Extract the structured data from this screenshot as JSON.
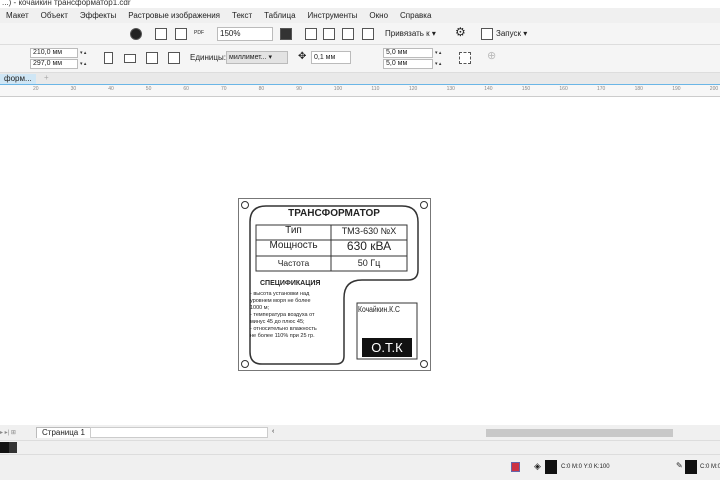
{
  "window": {
    "title": "...) - кочайкин трансформатор1.cdr"
  },
  "menu": [
    "Макет",
    "Объект",
    "Эффекты",
    "Растровые изображения",
    "Текст",
    "Таблица",
    "Инструменты",
    "Окно",
    "Справка"
  ],
  "toolbar": {
    "zoom": "150%",
    "snap_label": "Привязать к",
    "launch_label": "Запуск"
  },
  "propbar": {
    "width": "210,0 мм",
    "height": "297,0 мм",
    "units_label": "Единицы:",
    "units_value": "миллимет...",
    "nudge": "0,1 мм",
    "dup_x": "5,0 мм",
    "dup_y": "5,0 мм"
  },
  "doc_tab": "форм...",
  "ruler_ticks": [
    "20",
    "30",
    "40",
    "50",
    "60",
    "70",
    "80",
    "90",
    "100",
    "110",
    "120",
    "130",
    "140",
    "150",
    "160",
    "170",
    "180",
    "190",
    "200"
  ],
  "plate": {
    "title": "ТРАНСФОРМАТОР",
    "rows": [
      [
        "Тип",
        "ТМЗ-630 №X"
      ],
      [
        "Мощность",
        "630 кВА"
      ],
      [
        "Частота",
        "50 Гц"
      ]
    ],
    "spec_title": "СПЕЦИФИКАЦИЯ",
    "spec_lines": [
      "- высота установки над",
      "уровнем моря не более",
      "1000 м;",
      "- температура воздуха от",
      "минус 45 до плюс 45;",
      "- относительно влажность",
      "не более 110% при 25 гр."
    ],
    "signature": "Кочайкин.К.С",
    "stamp": "О.Т.К"
  },
  "page_tab": "Страница 1",
  "status": {
    "fill": "C:0 M:0 Y:0 K:100",
    "outline": "C:0 M:0 Y:0 K:"
  }
}
